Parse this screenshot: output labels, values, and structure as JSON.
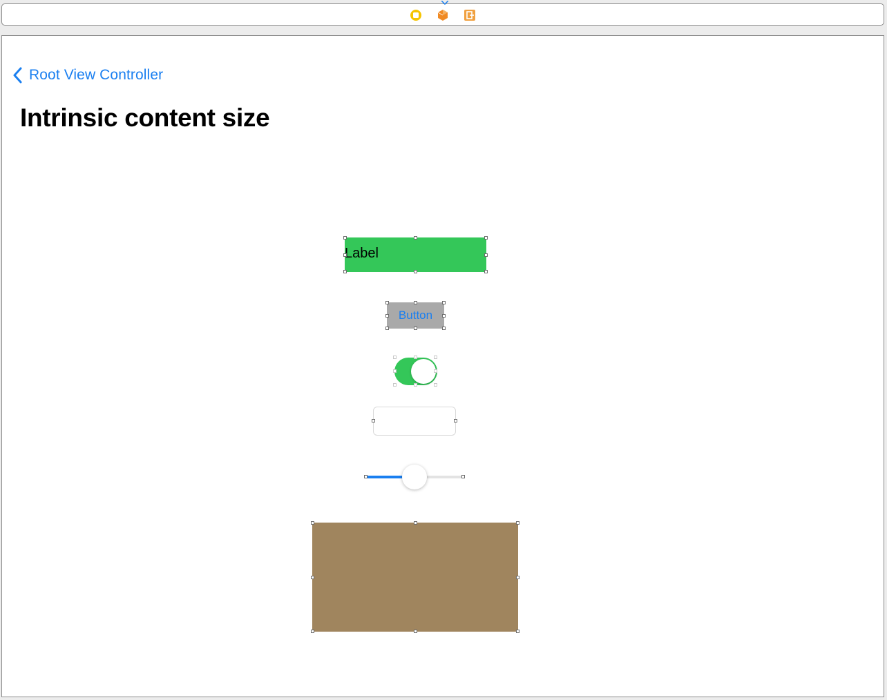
{
  "scene_dock": {
    "icons": {
      "view_controller": "view-controller-icon",
      "first_responder": "first-responder-icon",
      "exit": "exit-icon"
    },
    "colors": {
      "view_controller": "#f5c400",
      "first_responder": "#f08a24",
      "exit": "#f0a040"
    }
  },
  "navigation_bar": {
    "back_label": "Root View Controller",
    "large_title": "Intrinsic content size",
    "tint": "#1a7ff0"
  },
  "views": {
    "label": {
      "text": "Label",
      "background": "#34c759"
    },
    "button": {
      "title": "Button",
      "background": "#a9a9a9"
    },
    "switch": {
      "is_on": true,
      "on_tint": "#34c759"
    },
    "text_field": {
      "value": "",
      "placeholder": ""
    },
    "slider": {
      "value": 0.5,
      "min_track": "#1a7ff0",
      "max_track": "#e3e3e3"
    },
    "custom_view": {
      "background": "#a0855e"
    }
  }
}
